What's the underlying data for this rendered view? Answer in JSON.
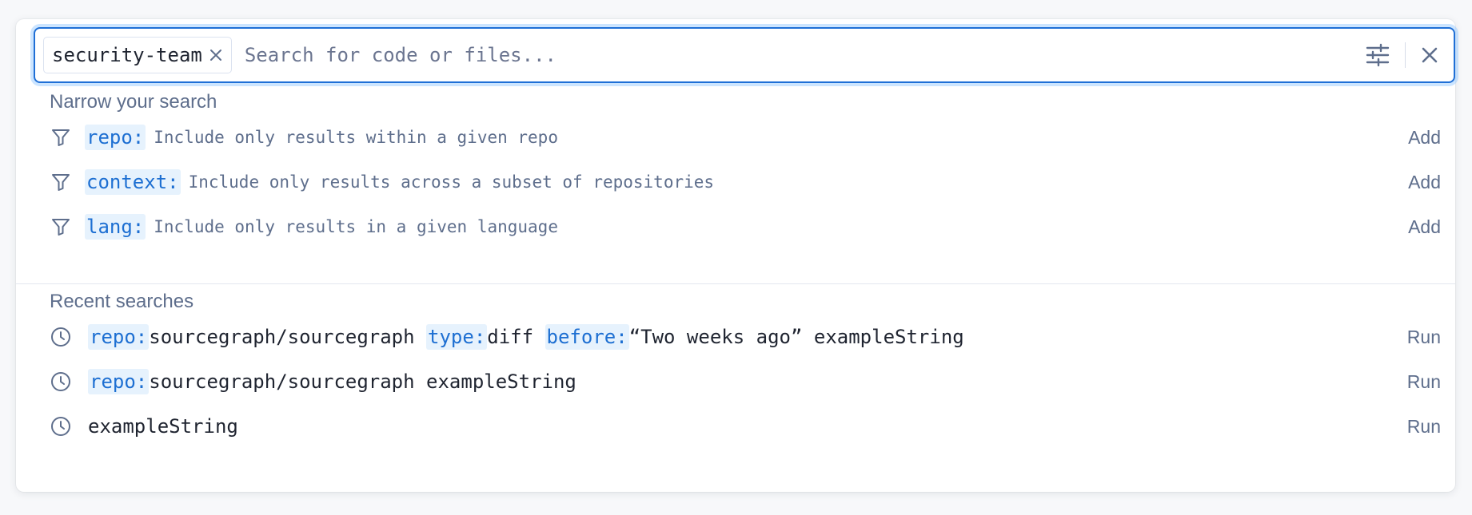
{
  "search": {
    "chip_label": "security-team",
    "placeholder": "Search for code or files..."
  },
  "narrow": {
    "title": "Narrow your search",
    "items": [
      {
        "keyword": "repo:",
        "description": "Include only results within a given repo",
        "action": "Add"
      },
      {
        "keyword": "context:",
        "description": "Include only results across a subset of repositories",
        "action": "Add"
      },
      {
        "keyword": "lang:",
        "description": "Include only results in a given language",
        "action": "Add"
      }
    ]
  },
  "recent": {
    "title": "Recent searches",
    "items": [
      {
        "parts": [
          {
            "kind": "kw",
            "text": "repo:"
          },
          {
            "kind": "plain",
            "text": "sourcegraph/sourcegraph "
          },
          {
            "kind": "kw",
            "text": "type:"
          },
          {
            "kind": "plain",
            "text": "diff "
          },
          {
            "kind": "kw",
            "text": "before:"
          },
          {
            "kind": "plain",
            "text": "“Two weeks ago” exampleString"
          }
        ],
        "action": "Run"
      },
      {
        "parts": [
          {
            "kind": "kw",
            "text": "repo:"
          },
          {
            "kind": "plain",
            "text": "sourcegraph/sourcegraph exampleString"
          }
        ],
        "action": "Run"
      },
      {
        "parts": [
          {
            "kind": "plain",
            "text": "exampleString"
          }
        ],
        "action": "Run"
      }
    ]
  },
  "colors": {
    "accent": "#1f6fd6",
    "keyword_bg": "#e6f2fd",
    "muted_text": "#5e6e8c"
  },
  "icons": {
    "chip_close": "close-icon",
    "filter_settings": "sliders-icon",
    "clear": "close-icon",
    "narrow_item": "filter-icon",
    "recent_item": "clock-icon"
  }
}
